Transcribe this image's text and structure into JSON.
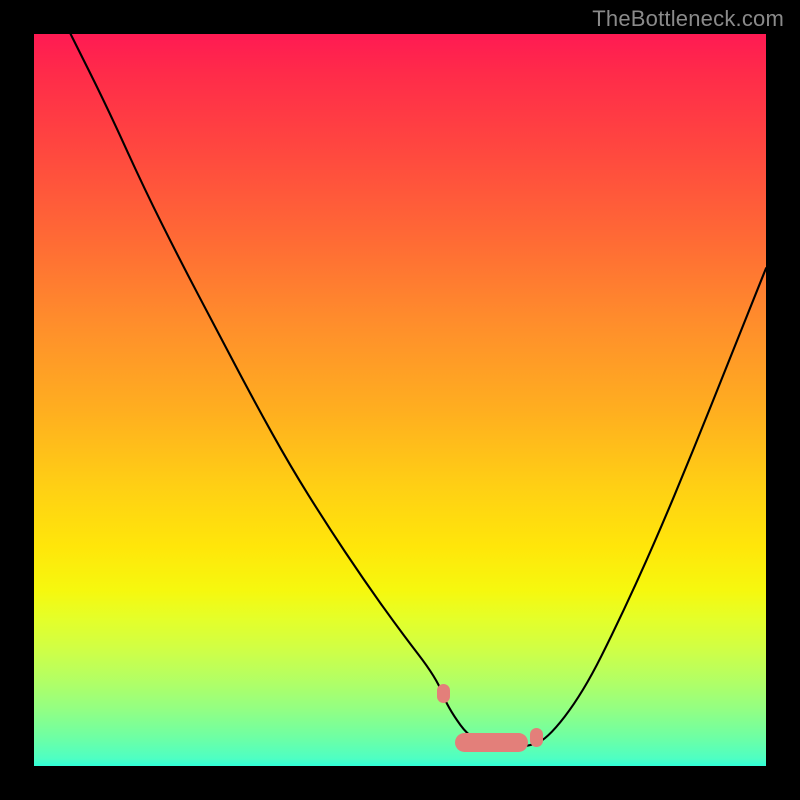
{
  "attribution": "TheBottleneck.com",
  "chart_data": {
    "type": "line",
    "title": "",
    "xlabel": "",
    "ylabel": "",
    "xlim": [
      0,
      100
    ],
    "ylim": [
      0,
      100
    ],
    "series": [
      {
        "name": "curve",
        "x": [
          5,
          10,
          15,
          20,
          25,
          30,
          35,
          40,
          45,
          50,
          55,
          56.5,
          60,
          65,
          67,
          70,
          75,
          80,
          85,
          90,
          95,
          100
        ],
        "values": [
          100,
          90,
          79,
          69,
          59.5,
          50,
          41,
          33,
          25.5,
          18.5,
          12,
          8,
          3.2,
          2.6,
          2.6,
          3.5,
          10,
          20,
          31,
          43,
          55.5,
          68
        ]
      }
    ],
    "accent_bands": [
      {
        "x_start": 55,
        "x_end": 56.8,
        "y": 10.0
      },
      {
        "x_start": 57.5,
        "x_end": 67.5,
        "y": 3.3
      },
      {
        "x_start": 67.8,
        "x_end": 69.5,
        "y": 3.9
      }
    ],
    "colors": {
      "curve": "#000000",
      "accent": "#e37f7a",
      "gradient_top": "#ff1a53",
      "gradient_bottom": "#30ffd9",
      "frame": "#000000"
    }
  }
}
